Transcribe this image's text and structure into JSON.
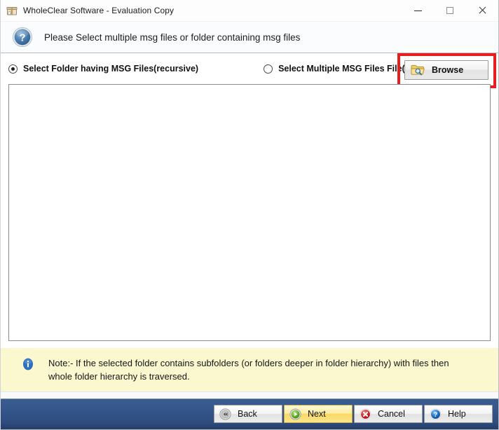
{
  "window": {
    "title": "WholeClear Software - Evaluation Copy",
    "app_icon": "package-box-icon",
    "controls": {
      "minimize": "minimize-icon",
      "maximize": "maximize-icon",
      "close": "close-icon"
    }
  },
  "header": {
    "icon": "blue-question-mark-icon",
    "instruction": "Please Select multiple msg files or folder containing msg files"
  },
  "options": {
    "selected": "folder_recursive",
    "items": [
      {
        "id": "folder_recursive",
        "label": "Select Folder having MSG Files(recursive)",
        "checked": true
      },
      {
        "id": "multiple_files",
        "label": "Select Multiple MSG Files File(s)",
        "checked": false
      }
    ]
  },
  "browse": {
    "label": "Browse",
    "icon": "folder-search-icon",
    "highlighted": true,
    "highlight_color": "#e81e1e"
  },
  "file_list": {
    "items": [],
    "empty": true
  },
  "note": {
    "icon": "info-icon",
    "text": "Note:- If the selected folder contains subfolders (or folders deeper in folder hierarchy) with files then whole folder hierarchy is traversed.",
    "background_color": "#fbf8cf"
  },
  "footer": {
    "background_color": "#34558a",
    "buttons": [
      {
        "id": "back",
        "label": "Back",
        "icon": "rewind-circle-icon",
        "primary": false
      },
      {
        "id": "next",
        "label": "Next",
        "icon": "play-circle-green-icon",
        "primary": true
      },
      {
        "id": "cancel",
        "label": "Cancel",
        "icon": "close-circle-red-icon",
        "primary": false
      },
      {
        "id": "help",
        "label": "Help",
        "icon": "question-circle-blue-icon",
        "primary": false
      }
    ]
  }
}
